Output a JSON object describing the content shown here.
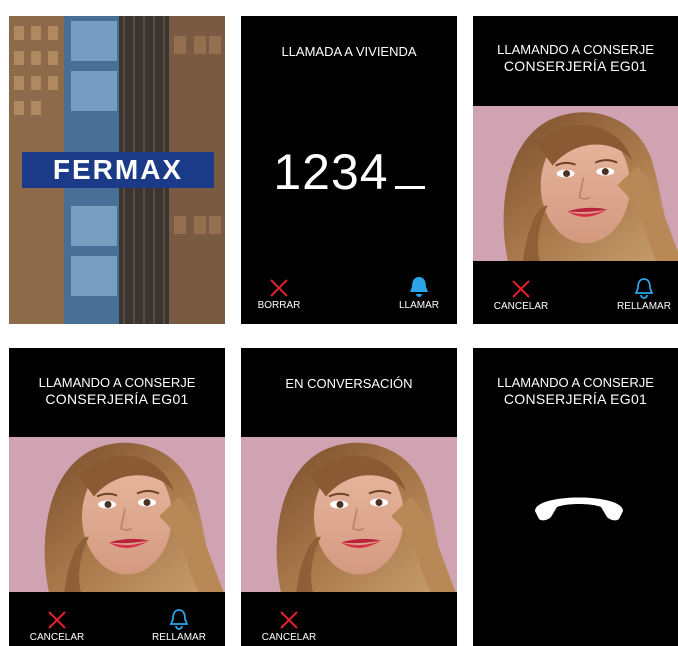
{
  "brand": {
    "logo_text": "FERMAX",
    "logo_color": "#1b3a87"
  },
  "screens": {
    "home": {},
    "dial": {
      "title": "LLAMADA A VIVIENDA",
      "number": "1234",
      "delete_label": "BORRAR",
      "call_label": "LLAMAR"
    },
    "calling1": {
      "title": "LLAMANDO A CONSERJE",
      "subtitle": "CONSERJERÍA EG01",
      "cancel_label": "CANCELAR",
      "redial_label": "RELLAMAR"
    },
    "calling2": {
      "title": "LLAMANDO A CONSERJE",
      "subtitle": "CONSERJERÍA EG01",
      "cancel_label": "CANCELAR",
      "redial_label": "RELLAMAR"
    },
    "conversation": {
      "title": "EN CONVERSACIÓN",
      "cancel_label": "CANCELAR"
    },
    "hangup": {
      "title": "LLAMANDO A CONSERJE",
      "subtitle": "CONSERJERÍA EG01"
    }
  },
  "colors": {
    "cancel": "#e0202b",
    "redial": "#2aa6e8",
    "panel_bg": "#000000",
    "text": "#ffffff"
  }
}
